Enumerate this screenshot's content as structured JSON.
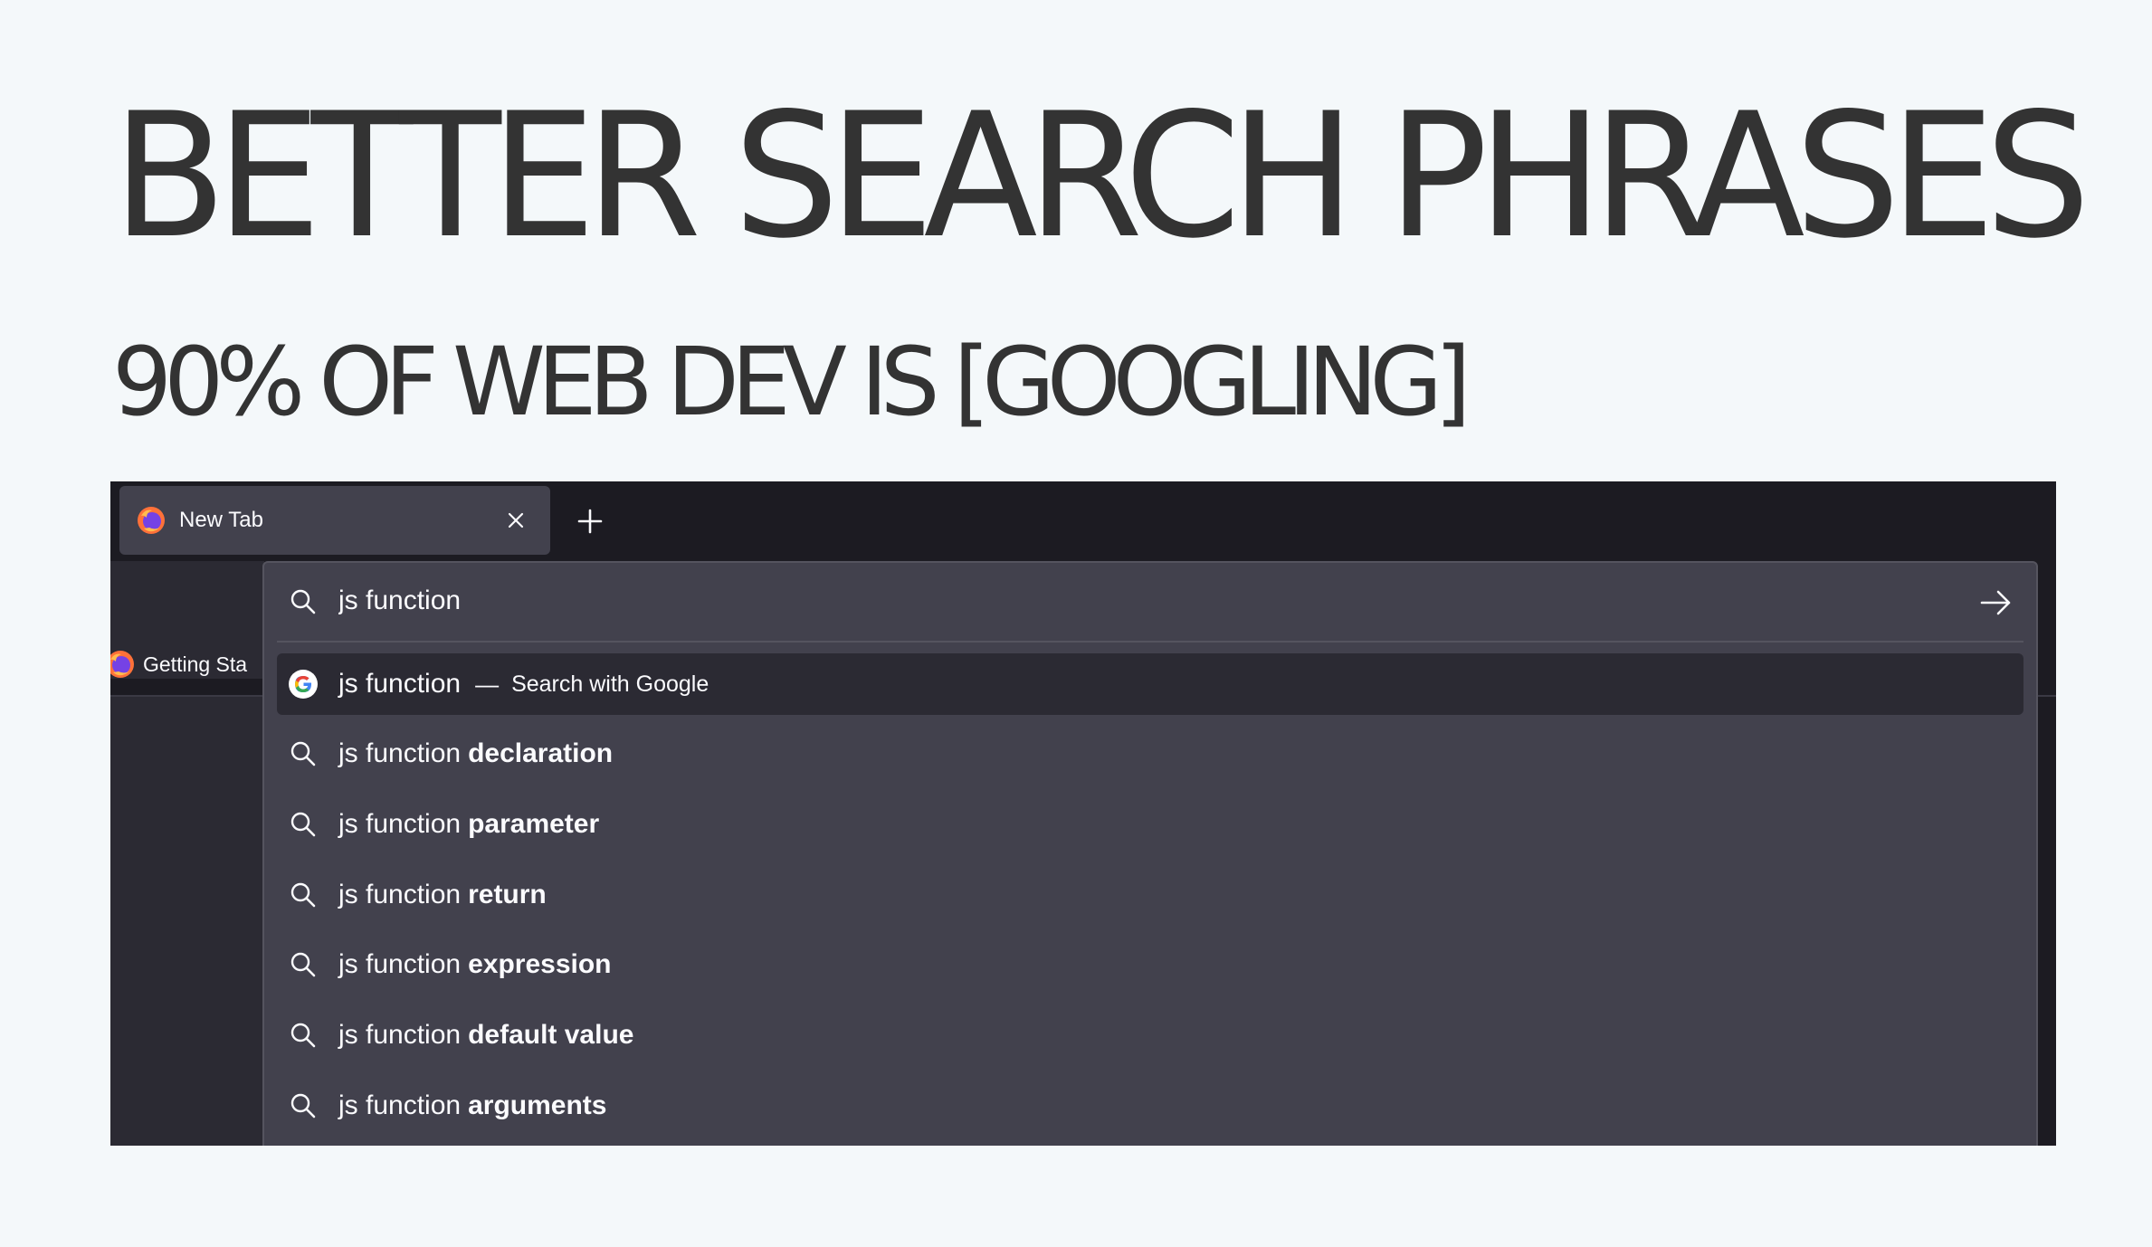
{
  "slide": {
    "title": "BETTER SEARCH PHRASES",
    "subtitle": "90% OF WEB DEV IS [GOOGLING]"
  },
  "browser": {
    "tab": {
      "title": "New Tab",
      "icon": "firefox-icon"
    },
    "bookmarks": [
      {
        "label": "Getting Sta",
        "icon": "firefox-icon"
      }
    ],
    "urlbar": {
      "value": "js function"
    },
    "suggestions": [
      {
        "prefix": "js function",
        "suffix": "",
        "action": "Search with Google",
        "separator": "—",
        "icon": "google-icon",
        "selected": true
      },
      {
        "prefix": "js function",
        "suffix": "declaration",
        "icon": "search-icon"
      },
      {
        "prefix": "js function",
        "suffix": "parameter",
        "icon": "search-icon"
      },
      {
        "prefix": "js function",
        "suffix": "return",
        "icon": "search-icon"
      },
      {
        "prefix": "js function",
        "suffix": "expression",
        "icon": "search-icon"
      },
      {
        "prefix": "js function",
        "suffix": "default value",
        "icon": "search-icon"
      },
      {
        "prefix": "js function",
        "suffix": "arguments",
        "icon": "search-icon"
      }
    ]
  },
  "colors": {
    "slide_background": "#f4f8fa",
    "title_text": "#333333",
    "tabstrip": "#1c1b22",
    "panel": "#42414d",
    "selected_row": "#2b2a33",
    "text": "#fbfbfe"
  }
}
